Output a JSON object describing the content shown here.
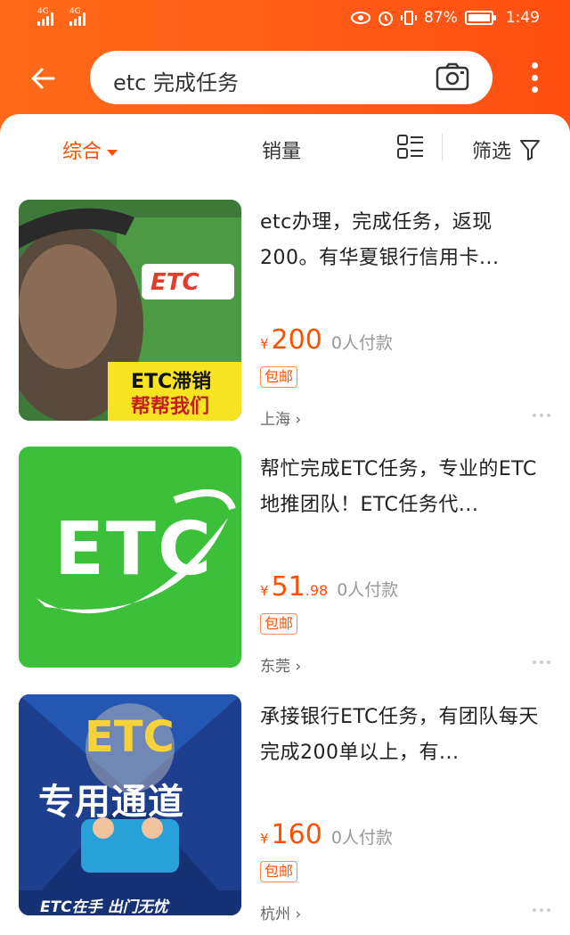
{
  "status": {
    "signal1": "4G",
    "signal2": "4G",
    "battery": "87%",
    "time": "1:49"
  },
  "search": {
    "query": "etc 完成任务"
  },
  "sort": {
    "comprehensive": "综合",
    "sales": "销量",
    "filter": "筛选"
  },
  "colors": {
    "brand": "#ff5000"
  },
  "items": [
    {
      "title": "etc办理，完成任务，返现200。有华夏银行信用卡...",
      "price_int": "200",
      "price_dec": "",
      "payers": "0人付款",
      "badge": "包邮",
      "location": "上海 ›",
      "thumb": {
        "logo": "ETC",
        "caption1": "ETC滞销",
        "caption2": "帮帮我们"
      }
    },
    {
      "title": "帮忙完成ETC任务，专业的ETC地推团队！ETC任务代...",
      "price_int": "51",
      "price_dec": ".98",
      "payers": "0人付款",
      "badge": "包邮",
      "location": "东莞 ›",
      "thumb": {
        "logo": "ETC"
      }
    },
    {
      "title": "承接银行ETC任务，有团队每天完成200单以上，有...",
      "price_int": "160",
      "price_dec": "",
      "payers": "0人付款",
      "badge": "包邮",
      "location": "杭州 ›",
      "thumb": {
        "logo": "ETC",
        "caption1": "专用通道",
        "caption2": "ETC在手 出门无忧"
      }
    }
  ]
}
